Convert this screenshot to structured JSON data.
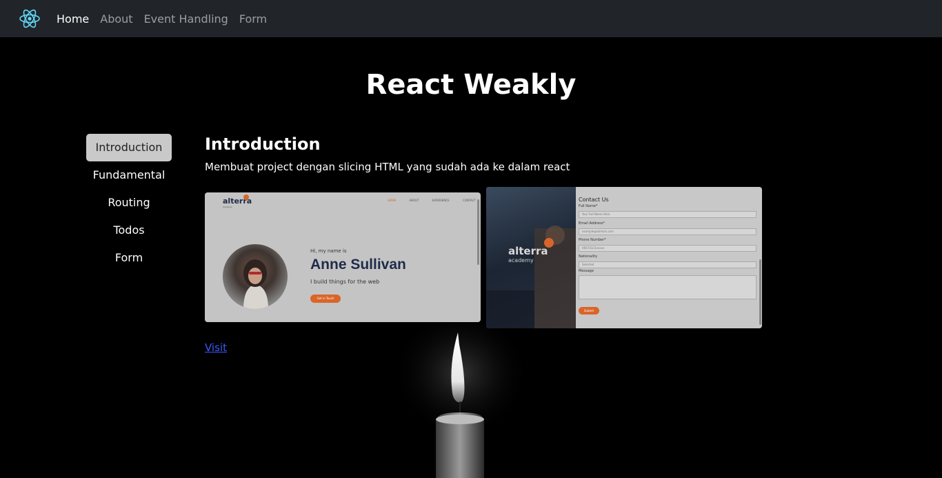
{
  "nav": {
    "items": [
      {
        "label": "Home",
        "active": true
      },
      {
        "label": "About",
        "active": false
      },
      {
        "label": "Event Handling",
        "active": false
      },
      {
        "label": "Form",
        "active": false
      }
    ]
  },
  "page": {
    "title": "React Weakly"
  },
  "sidebar": {
    "items": [
      {
        "label": "Introduction",
        "active": true
      },
      {
        "label": "Fundamental",
        "active": false
      },
      {
        "label": "Routing",
        "active": false
      },
      {
        "label": "Todos",
        "active": false
      },
      {
        "label": "Form",
        "active": false
      }
    ]
  },
  "content": {
    "title": "Introduction",
    "description": "Membuat project dengan slicing HTML yang sudah ada ke dalam react",
    "visit_label": "Visit"
  },
  "screenshot1": {
    "logo": "alterra",
    "logo_sub": "academy",
    "nav": [
      "HOME",
      "ABOUT",
      "EXPERIENCE",
      "CONTACT"
    ],
    "greeting": "Hi, my name is",
    "name": "Anne Sullivan",
    "tagline": "I build things for the web",
    "button": "Get in Touch"
  },
  "screenshot2": {
    "logo": "alterra",
    "logo_sub": "academy",
    "form_title": "Contact Us",
    "fields": [
      {
        "label": "Full Name*",
        "placeholder": "Your Full Name Here"
      },
      {
        "label": "Email Address*",
        "placeholder": "example@domain.com"
      },
      {
        "label": "Phone Number*",
        "placeholder": "08573121xxxxx"
      },
      {
        "label": "Nationality",
        "placeholder": "Selected"
      }
    ],
    "message_label": "Message",
    "submit": "Submit"
  },
  "colors": {
    "navbar": "#212529",
    "accent_orange": "#d9652a",
    "link": "#3b5bff",
    "active_sidebar": "#c9c9c9"
  }
}
